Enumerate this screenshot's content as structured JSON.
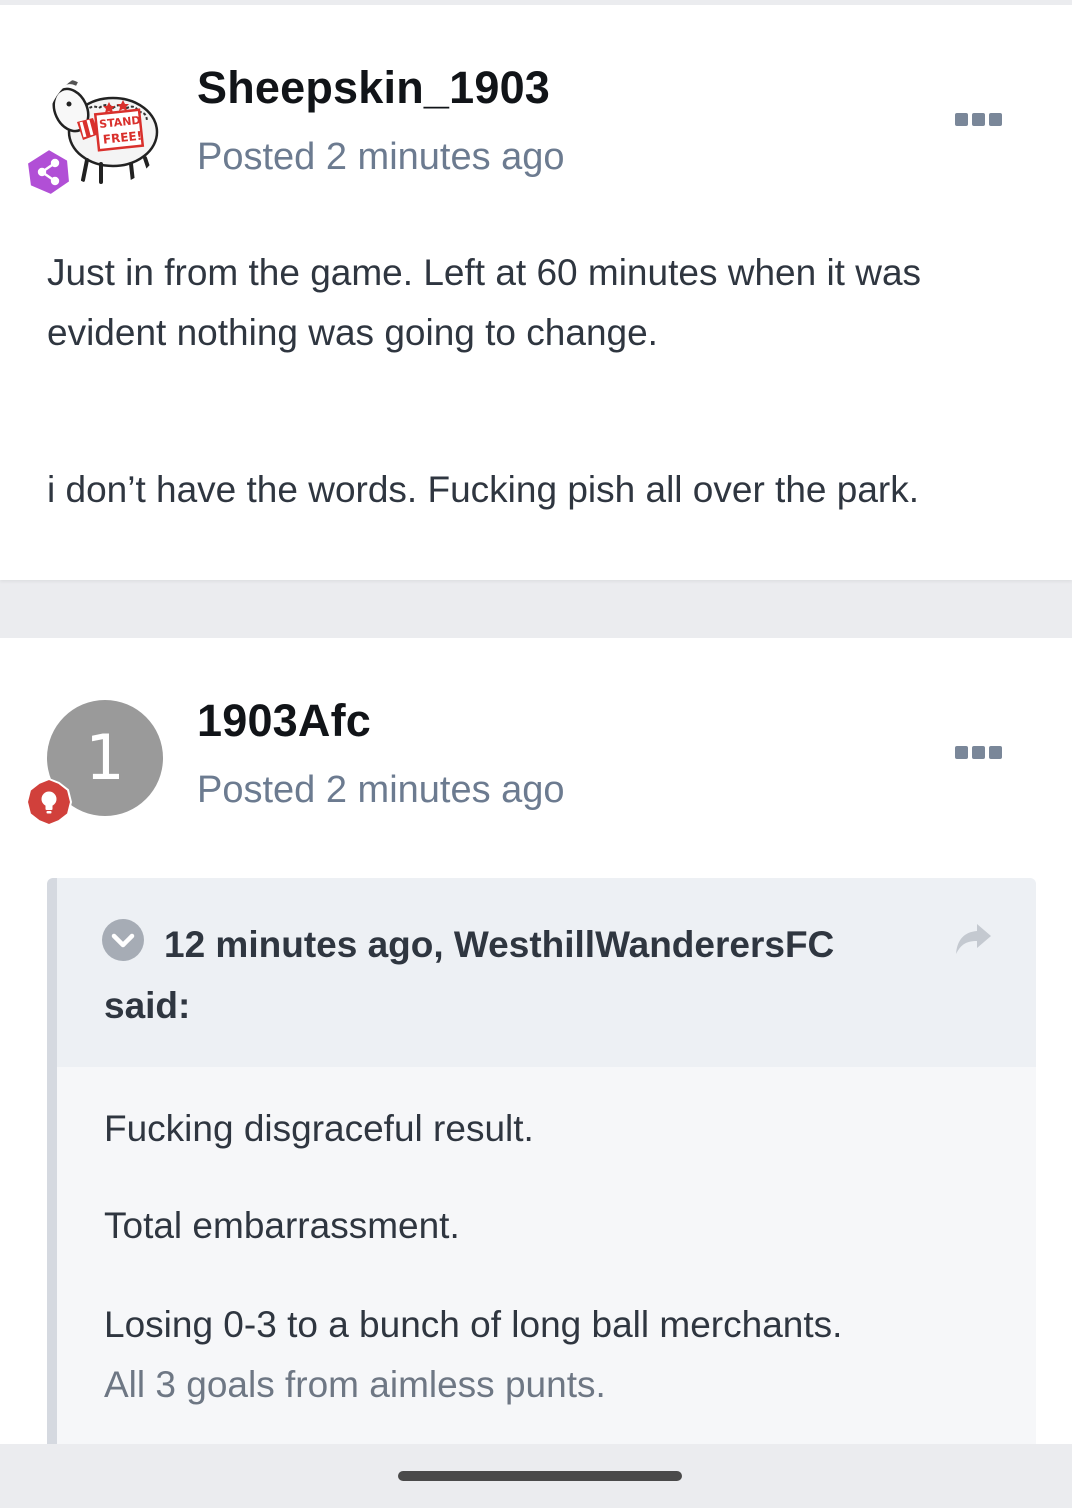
{
  "posts": [
    {
      "author": "Sheepskin_1903",
      "posted": "Posted 2 minutes ago",
      "badge_icon": "share-nodes-icon",
      "badge_color": "#b14fd6",
      "avatar": "stand-free-sheep-avatar",
      "avatar_sign": [
        "STAND",
        "FREE!"
      ],
      "body": [
        "Just in from the game. Left at 60 minutes when it was evident nothing was going to change.",
        "i don’t have the words. Fucking pish all over the park."
      ]
    },
    {
      "author": "1903Afc",
      "posted": "Posted 2 minutes ago",
      "avatar_letter": "1",
      "avatar_color": "#9a9a9a",
      "badge_icon": "lightbulb-icon",
      "badge_color": "#d1403b",
      "quote": {
        "citation": "12 minutes ago, WesthillWanderersFC said:",
        "lines": [
          "Fucking disgraceful result.",
          "Total embarrassment.",
          "Losing 0-3 to a bunch of long ball merchants.",
          "All 3 goals from aimless punts."
        ]
      }
    }
  ]
}
